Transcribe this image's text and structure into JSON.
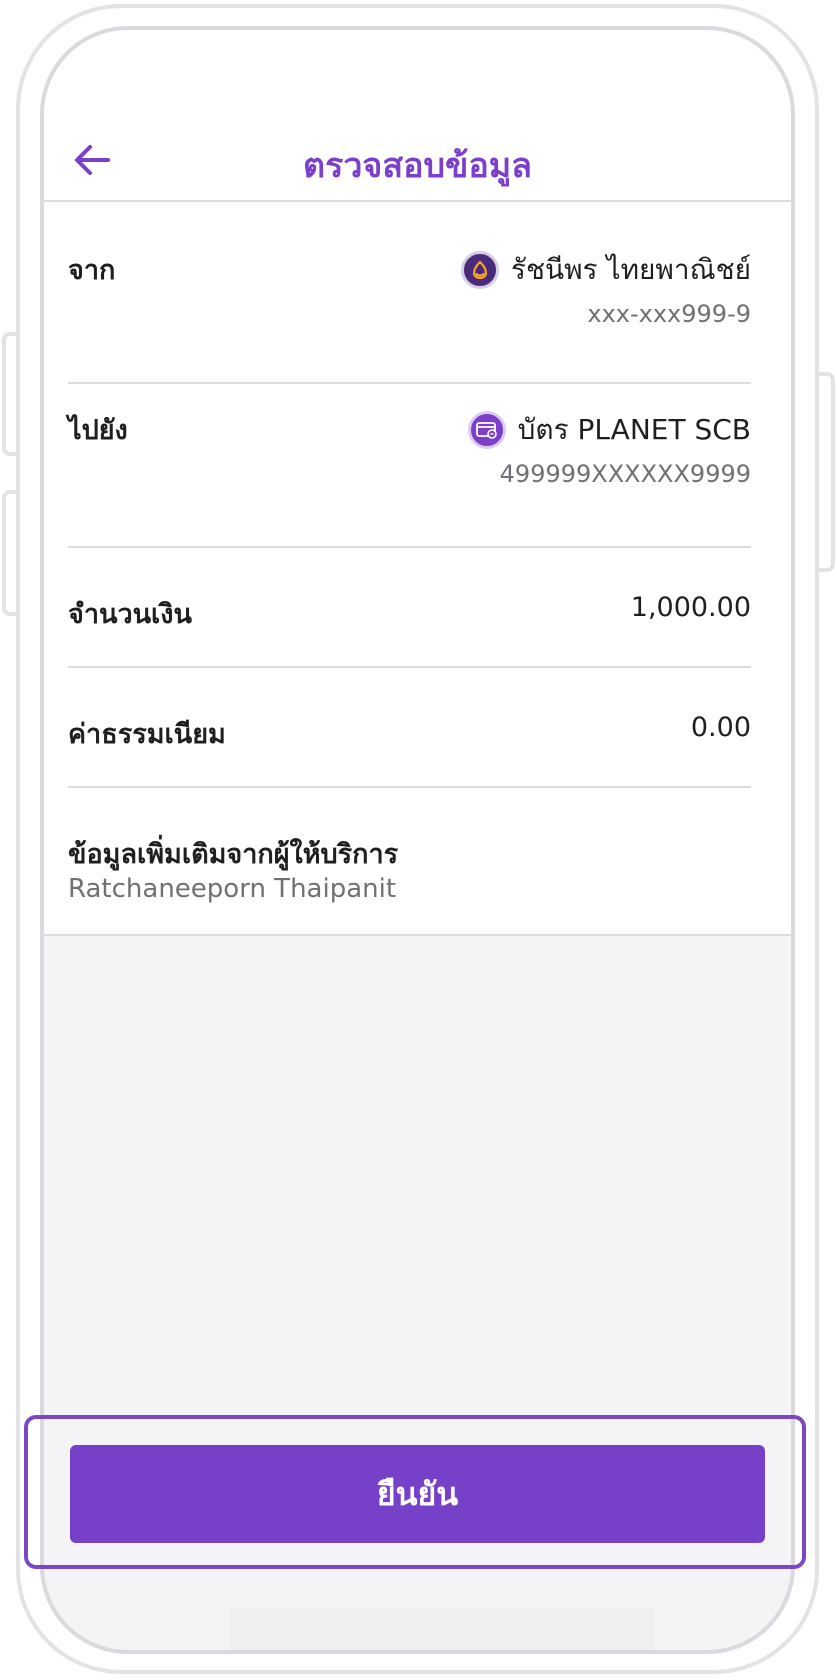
{
  "header": {
    "title": "ตรวจสอบข้อมูล"
  },
  "from": {
    "label": "จาก",
    "account_name": "รัชนีพร ไทยพาณิชย์",
    "account_number": "xxx-xxx999-9",
    "icon": "scb-bank-icon"
  },
  "to": {
    "label": "ไปยัง",
    "card_name": "บัตร PLANET SCB",
    "card_number": "499999XXXXXX9999",
    "icon": "credit-card-icon"
  },
  "amount": {
    "label": "จำนวนเงิน",
    "value": "1,000.00"
  },
  "fee": {
    "label": "ค่าธรรมเนียม",
    "value": "0.00"
  },
  "provider_info": {
    "label": "ข้อมูลเพิ่มเติมจากผู้ให้บริการ",
    "value": "Ratchaneeporn Thaipanit"
  },
  "confirm": {
    "label": "ยืนยัน"
  },
  "colors": {
    "accent": "#7b3fc9",
    "button": "#7640c8",
    "background": "#f4f4f7"
  }
}
